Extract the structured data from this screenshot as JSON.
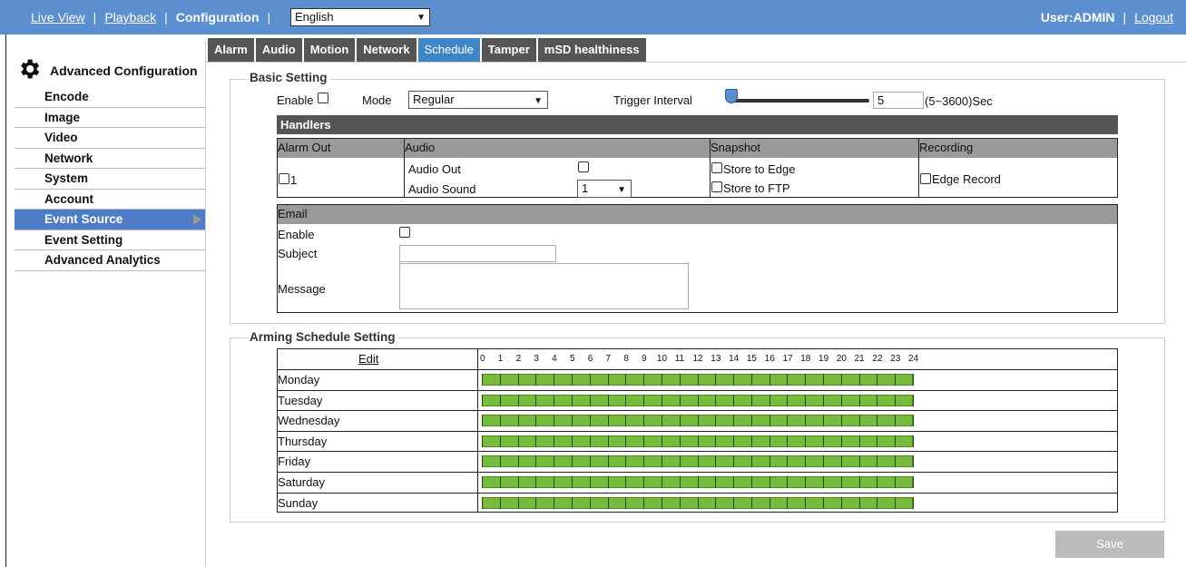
{
  "topbar": {
    "live_view": "Live View",
    "playback": "Playback",
    "configuration": "Configuration",
    "separator": "|",
    "language": "English",
    "user": "User:ADMIN",
    "logout": "Logout"
  },
  "sidebar": {
    "title": "Advanced Configuration",
    "items": [
      {
        "label": "Encode"
      },
      {
        "label": "Image"
      },
      {
        "label": "Video"
      },
      {
        "label": "Network"
      },
      {
        "label": "System"
      },
      {
        "label": "Account"
      },
      {
        "label": "Event Source"
      },
      {
        "label": "Event Setting"
      },
      {
        "label": "Advanced Analytics"
      }
    ],
    "active": "Event Source"
  },
  "tabs": [
    {
      "label": "Alarm"
    },
    {
      "label": "Audio"
    },
    {
      "label": "Motion"
    },
    {
      "label": "Network"
    },
    {
      "label": "Schedule"
    },
    {
      "label": "Tamper"
    },
    {
      "label": "mSD healthiness"
    }
  ],
  "active_tab": "Schedule",
  "basic": {
    "legend": "Basic Setting",
    "enable_label": "Enable",
    "mode_label": "Mode",
    "mode_value": "Regular",
    "trigger_label": "Trigger Interval",
    "trigger_value": "5",
    "trigger_range": "(5~3600)Sec",
    "slider_level": 0.0
  },
  "handlers": {
    "title": "Handlers",
    "alarm_out_header": "Alarm Out",
    "audio_header": "Audio",
    "snapshot_header": "Snapshot",
    "recording_header": "Recording",
    "alarm_out_1": "1",
    "audio_out": "Audio Out",
    "audio_sound": "Audio Sound",
    "audio_sound_value": "1",
    "store_edge": "Store to Edge",
    "store_ftp": "Store to FTP",
    "edge_record": "Edge Record"
  },
  "email": {
    "header": "Email",
    "enable": "Enable",
    "subject": "Subject",
    "message": "Message"
  },
  "schedule": {
    "legend": "Arming Schedule Setting",
    "edit": "Edit",
    "hours": [
      "0",
      "1",
      "2",
      "3",
      "4",
      "5",
      "6",
      "7",
      "8",
      "9",
      "10",
      "11",
      "12",
      "13",
      "14",
      "15",
      "16",
      "17",
      "18",
      "19",
      "20",
      "21",
      "22",
      "23",
      "24"
    ],
    "days": [
      "Monday",
      "Tuesday",
      "Wednesday",
      "Thursday",
      "Friday",
      "Saturday",
      "Sunday"
    ],
    "armed_hours": [
      [
        0,
        24
      ],
      [
        0,
        24
      ],
      [
        0,
        24
      ],
      [
        0,
        24
      ],
      [
        0,
        24
      ],
      [
        0,
        24
      ],
      [
        0,
        24
      ]
    ]
  },
  "save_label": "Save",
  "colors": {
    "topbar": "#5b8fd0",
    "active_tab": "#3f86c9",
    "tab": "#555555",
    "schedule_fill": "#76bb3b"
  }
}
